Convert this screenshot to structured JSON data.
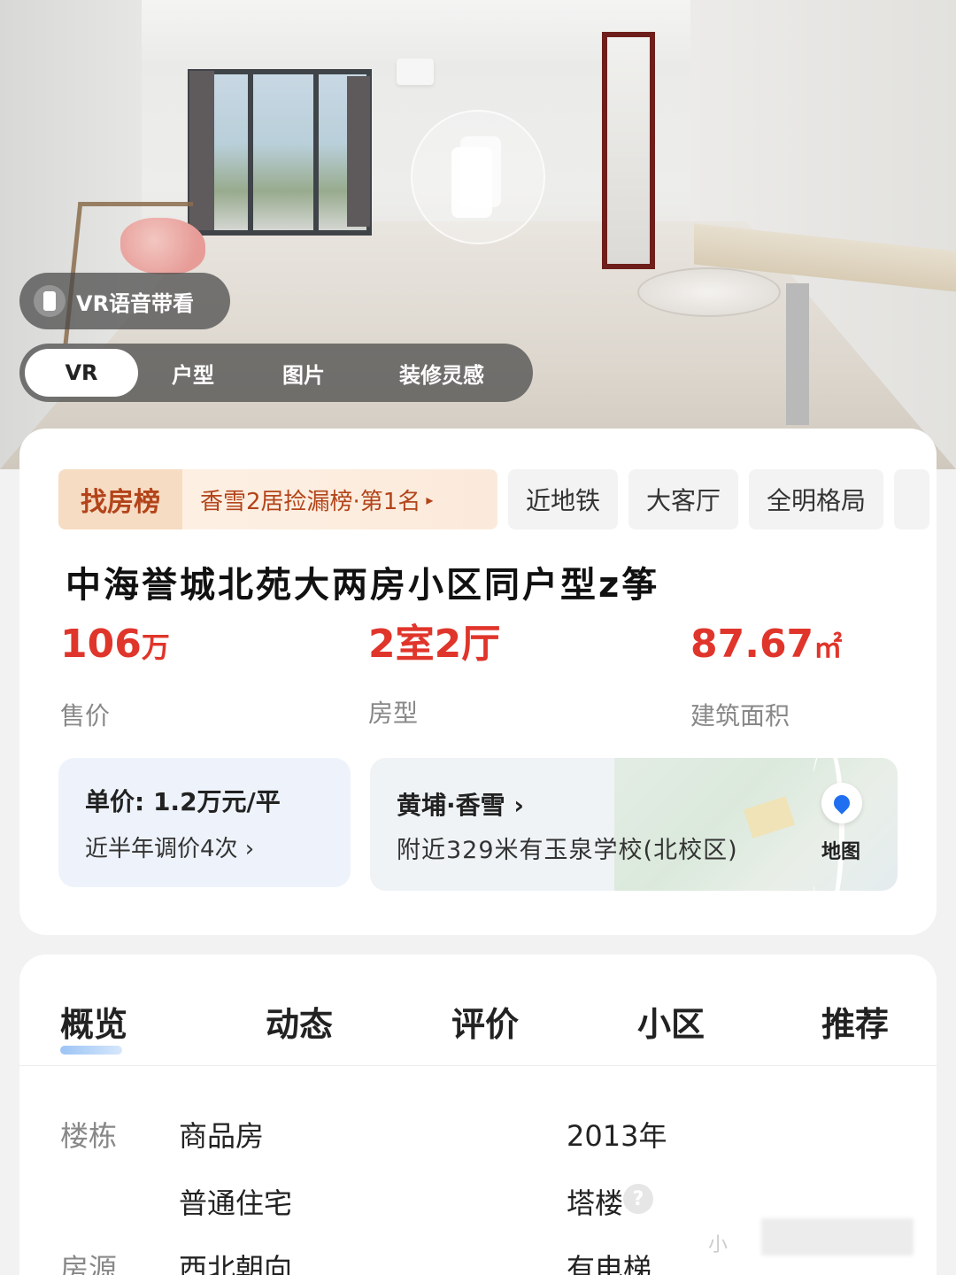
{
  "hero": {
    "voice_guide_label": "VR语音带看",
    "media_tabs": [
      "VR",
      "户型",
      "图片",
      "装修灵感"
    ]
  },
  "tags": {
    "rank_title": "找房榜",
    "rank_text": "香雪2居捡漏榜·第1名",
    "rank_arrow": "▸",
    "features": [
      "近地铁",
      "大客厅",
      "全明格局"
    ]
  },
  "listing": {
    "title": "中海誉城北苑大两房小区同户型z筝",
    "price_value": "106",
    "price_unit": "万",
    "price_label": "售价",
    "layout_value": "2室2厅",
    "layout_label": "房型",
    "area_value": "87.67",
    "area_unit": "㎡",
    "area_label": "建筑面积"
  },
  "price_box": {
    "unit_price": "单价: 1.2万元/平",
    "adjust_note": "近半年调价4次 ›"
  },
  "location": {
    "district": "黄埔·香雪 ›",
    "nearby": "附近329米有玉泉学校(北校区)",
    "map_label": "地图"
  },
  "section_tabs": [
    "概览",
    "动态",
    "评价",
    "小区",
    "推荐"
  ],
  "details": {
    "building_label": "楼栋",
    "property_type": "商品房",
    "residence_type": "普通住宅",
    "built_year": "2013年",
    "building_style": "塔楼",
    "source_label": "房源",
    "orientation": "西北朝向",
    "elevator": "有电梯",
    "partial_text": "小"
  },
  "colors": {
    "price_red": "#e0352b",
    "rank_orange": "#b3441a",
    "map_pin_blue": "#1f6ff0"
  }
}
